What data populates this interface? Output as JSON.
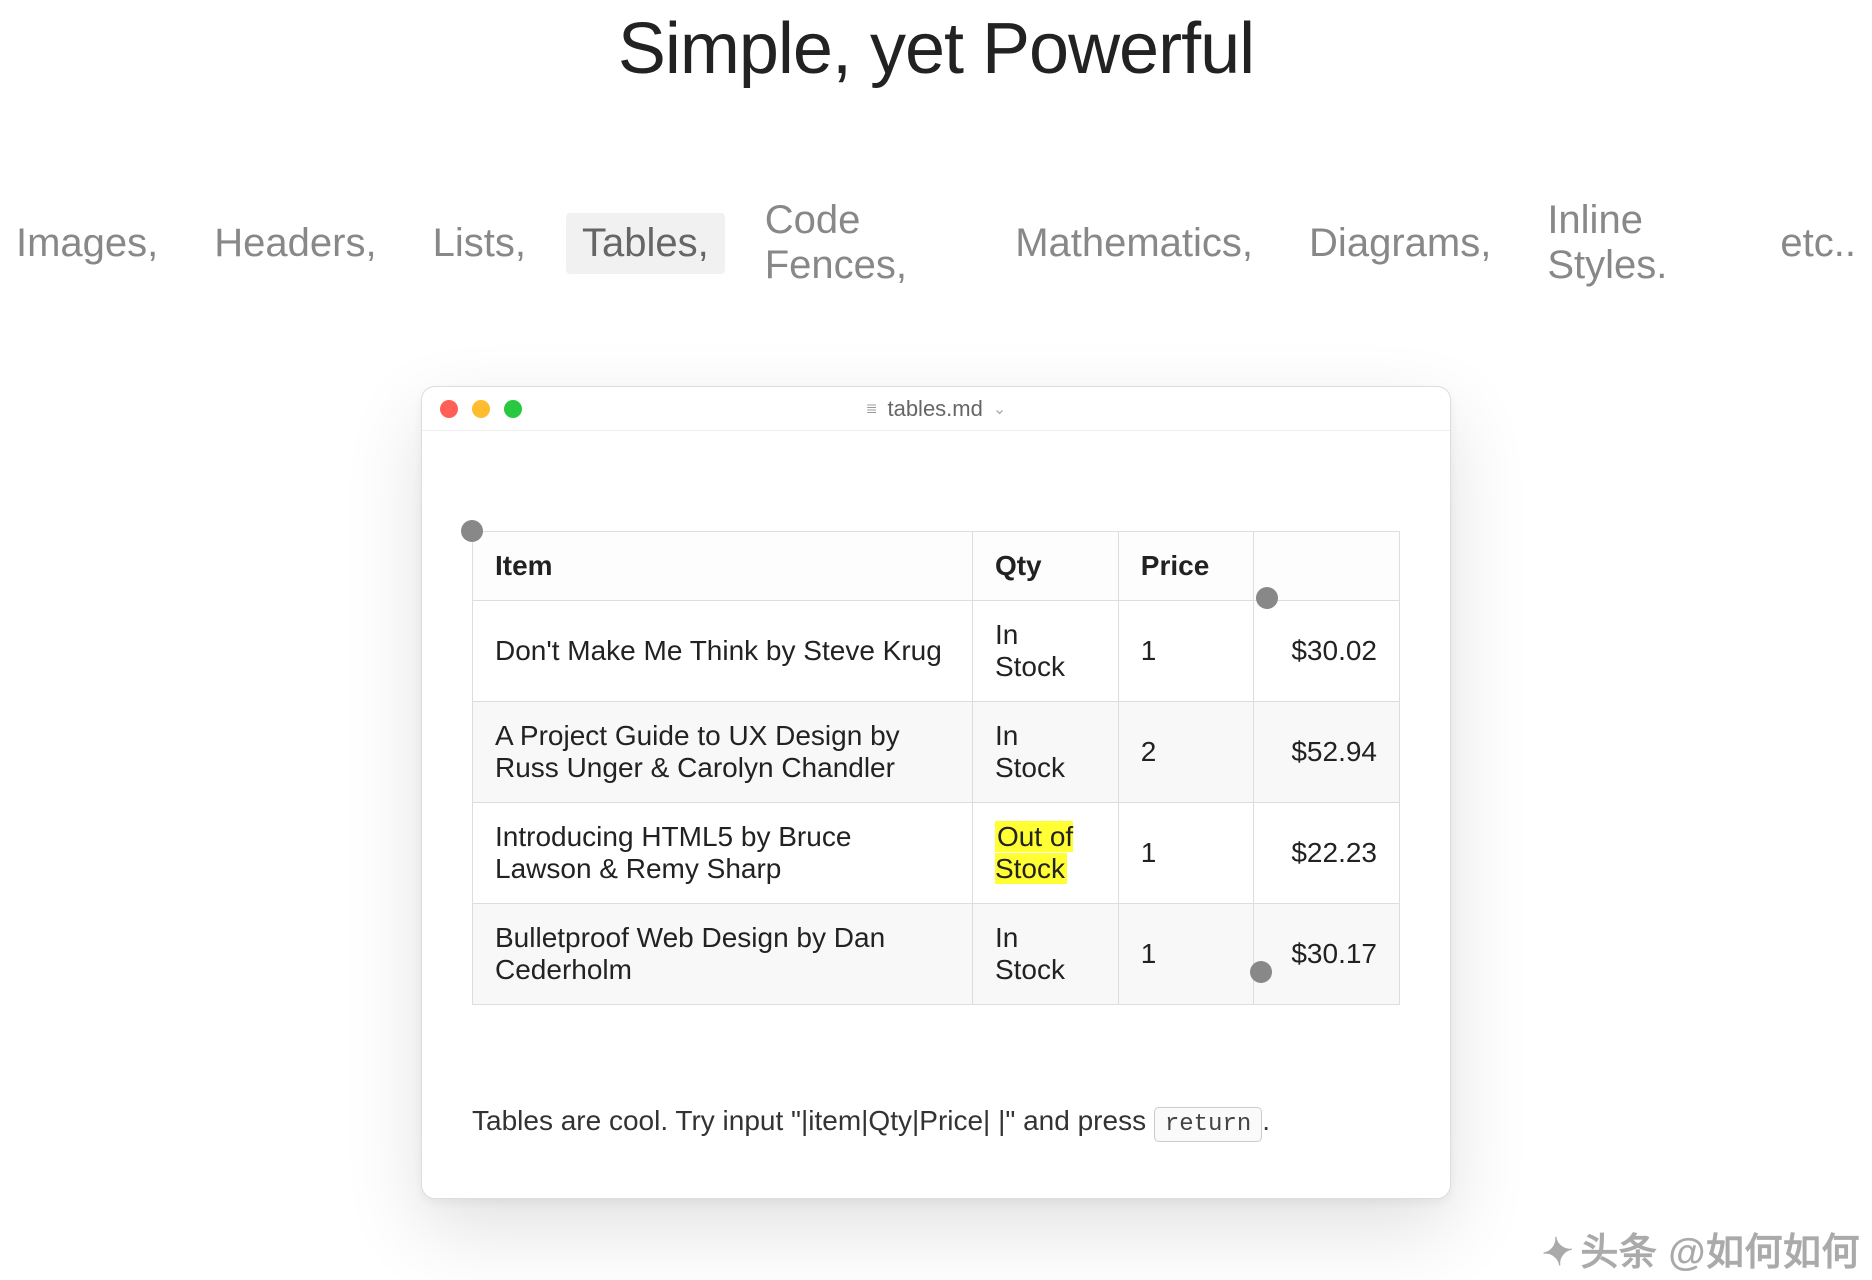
{
  "heading": "Simple, yet Powerful",
  "tabs": {
    "items": [
      {
        "label": "Images,",
        "active": false
      },
      {
        "label": "Headers,",
        "active": false
      },
      {
        "label": "Lists,",
        "active": false
      },
      {
        "label": "Tables,",
        "active": true
      },
      {
        "label": "Code Fences,",
        "active": false
      },
      {
        "label": "Mathematics,",
        "active": false
      },
      {
        "label": "Diagrams,",
        "active": false
      },
      {
        "label": "Inline Styles.",
        "active": false
      },
      {
        "label": "etc..",
        "active": false
      }
    ]
  },
  "window": {
    "filename": "tables.md"
  },
  "table": {
    "headers": [
      "Item",
      "Qty",
      "Price",
      ""
    ],
    "rows": [
      {
        "item": "Don't Make Me Think by Steve Krug",
        "qty": "In Stock",
        "count": "1",
        "price": "$30.02",
        "highlight_qty": false
      },
      {
        "item": "A Project Guide to UX Design by Russ Unger & Carolyn Chandler",
        "qty": "In Stock",
        "count": "2",
        "price": "$52.94",
        "highlight_qty": false
      },
      {
        "item": "Introducing HTML5 by Bruce Lawson & Remy Sharp",
        "qty": "Out of Stock",
        "count": "1",
        "price": "$22.23",
        "highlight_qty": true
      },
      {
        "item": "Bulletproof Web Design by Dan Cederholm",
        "qty": "In Stock",
        "count": "1",
        "price": "$30.17",
        "highlight_qty": false
      }
    ]
  },
  "hint": {
    "prefix": "Tables are cool. Try input \"|item|Qty|Price| |\" and press ",
    "key": "return",
    "suffix": "."
  },
  "watermark": "头条 @如何如何"
}
